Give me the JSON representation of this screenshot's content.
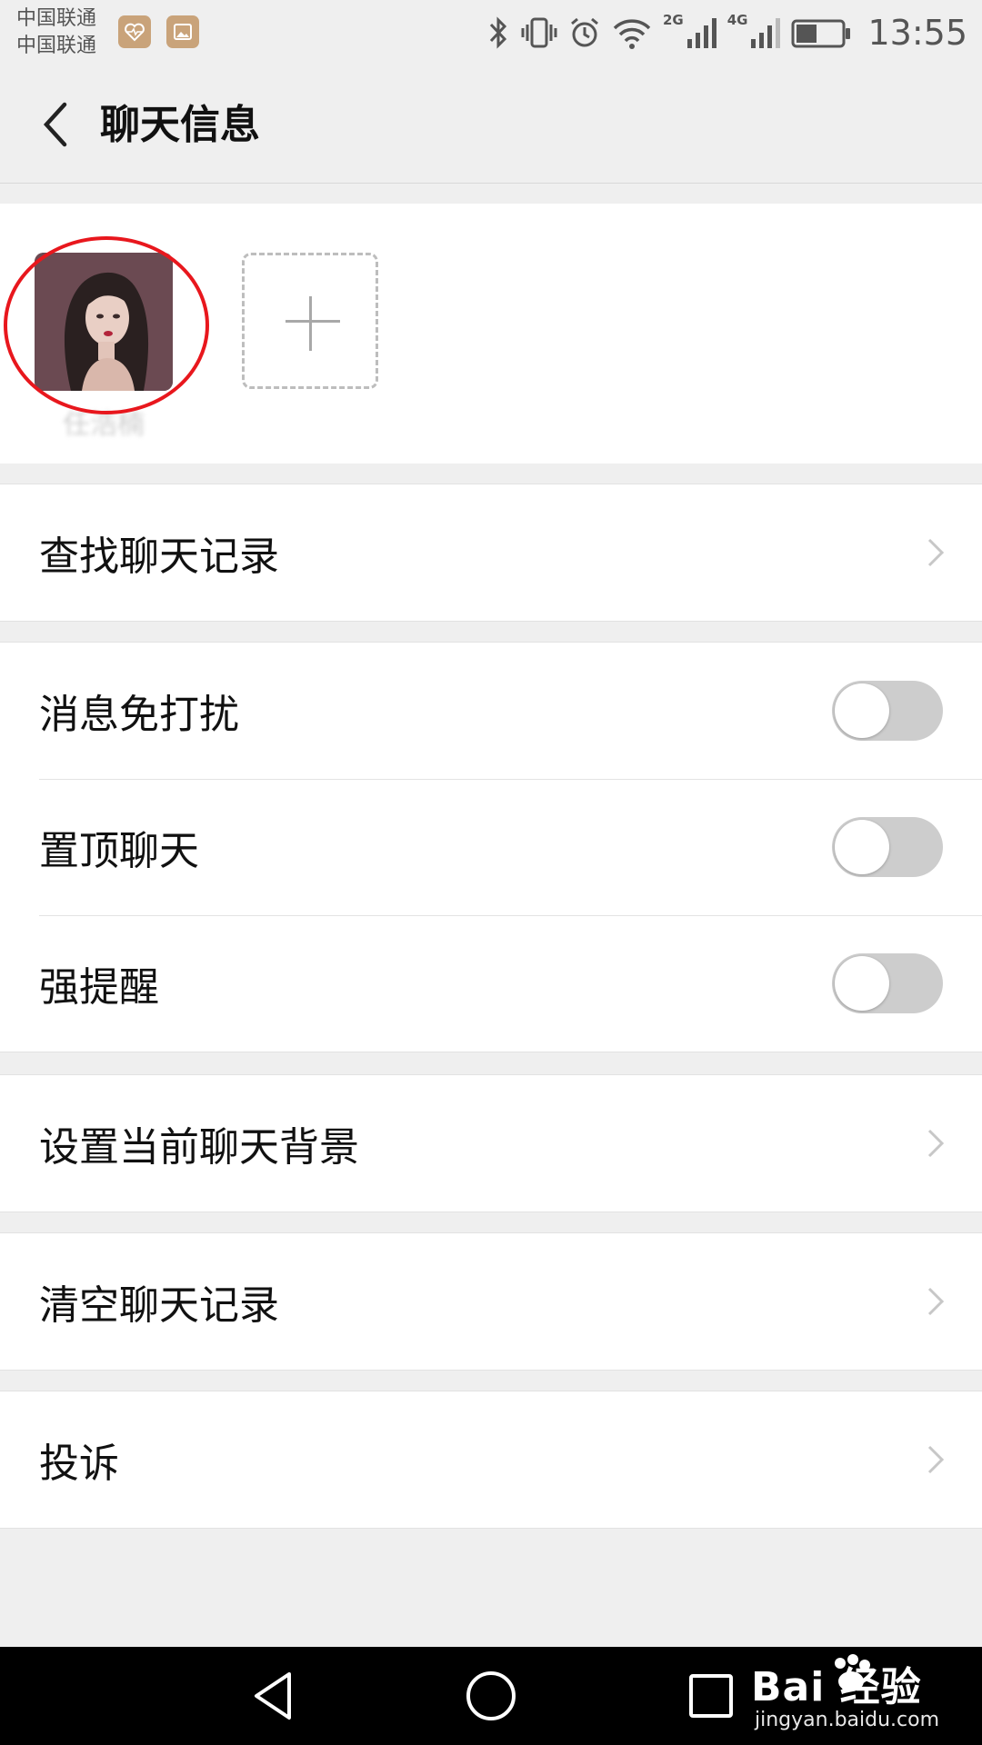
{
  "status_bar": {
    "carrier_1": "中国联通",
    "carrier_2": "中国联通",
    "network_2g": "2G",
    "network_4g": "4G",
    "battery_level": 0.45,
    "time": "13:55",
    "icons": [
      "health-app-icon",
      "gallery-app-icon",
      "bluetooth-icon",
      "vibrate-icon",
      "alarm-icon",
      "wifi-icon",
      "signal-2g-icon",
      "signal-4g-icon",
      "battery-icon"
    ]
  },
  "header": {
    "title": "聊天信息",
    "back_icon": "chevron-left-icon"
  },
  "members": {
    "items": [
      {
        "name": "任浩楠"
      }
    ],
    "add_icon": "plus-icon",
    "highlight_color": "#e8171d"
  },
  "sections": {
    "search": {
      "label": "查找聊天记录"
    },
    "settings": {
      "mute": {
        "label": "消息免打扰",
        "on": false
      },
      "pin": {
        "label": "置顶聊天",
        "on": false
      },
      "alert": {
        "label": "强提醒",
        "on": false
      }
    },
    "background": {
      "label": "设置当前聊天背景"
    },
    "clear": {
      "label": "清空聊天记录"
    },
    "report": {
      "label": "投诉"
    }
  },
  "nav_bar": {
    "icons": [
      "triangle-back-icon",
      "circle-home-icon",
      "square-recent-icon"
    ]
  },
  "watermark": {
    "brand": "Bai 经验",
    "url": "jingyan.baidu.com"
  },
  "colors": {
    "toggle_off": "#cdcdcd",
    "background": "#efefef"
  }
}
